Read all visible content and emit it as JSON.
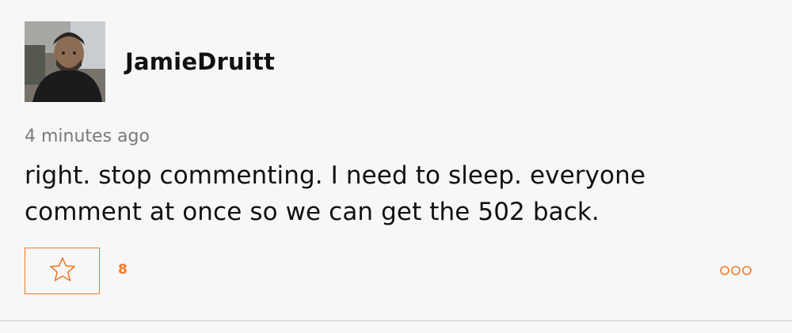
{
  "comment": {
    "author": "JamieDruitt",
    "timestamp": "4 minutes ago",
    "body": "right. stop commenting. I need to sleep. everyone comment at once so we can get the 502 back.",
    "like_count": "8"
  },
  "icons": {
    "avatar": "user-avatar-photo",
    "star": "star-outline-icon",
    "more": "more-options-icon"
  },
  "colors": {
    "accent": "#f07a2a",
    "background": "#f7f7f7",
    "text": "#111111",
    "muted": "#7a7a7a",
    "divider": "#cfcfcf"
  }
}
